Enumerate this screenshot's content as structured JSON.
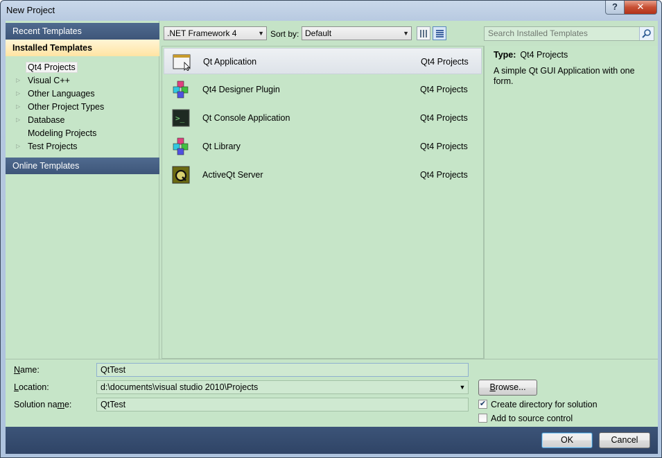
{
  "window": {
    "title": "New Project",
    "help_label": "?",
    "close_label": "✕"
  },
  "left_panel": {
    "recent_label": "Recent Templates",
    "installed_label": "Installed Templates",
    "online_label": "Online Templates",
    "tree": [
      {
        "label": "Qt4 Projects",
        "expandable": false,
        "selected": true
      },
      {
        "label": "Visual C++",
        "expandable": true
      },
      {
        "label": "Other Languages",
        "expandable": true
      },
      {
        "label": "Other Project Types",
        "expandable": true
      },
      {
        "label": "Database",
        "expandable": true
      },
      {
        "label": "Modeling Projects",
        "expandable": false
      },
      {
        "label": "Test Projects",
        "expandable": true
      }
    ]
  },
  "toolbar": {
    "framework": ".NET Framework 4",
    "sort_label": "Sort by:",
    "sort_value": "Default",
    "search_placeholder": "Search Installed Templates"
  },
  "templates": [
    {
      "name": "Qt Application",
      "category": "Qt4 Projects",
      "icon": "window-icon",
      "selected": true
    },
    {
      "name": "Qt4 Designer Plugin",
      "category": "Qt4 Projects",
      "icon": "cubes-icon"
    },
    {
      "name": "Qt Console Application",
      "category": "Qt4 Projects",
      "icon": "console-icon"
    },
    {
      "name": "Qt Library",
      "category": "Qt4 Projects",
      "icon": "cubes-icon"
    },
    {
      "name": "ActiveQt Server",
      "category": "Qt4 Projects",
      "icon": "activeqt-icon"
    }
  ],
  "details": {
    "type_label": "Type:",
    "type_value": "Qt4 Projects",
    "description": "A simple Qt GUI Application with one form."
  },
  "form": {
    "name_label": "Name:",
    "name_value": "QtTest",
    "location_label": "Location:",
    "location_value": "d:\\documents\\visual studio 2010\\Projects",
    "solution_label": "Solution name:",
    "solution_value": "QtTest",
    "browse_label": "Browse...",
    "create_dir_label": "Create directory for solution",
    "create_dir_checked": true,
    "source_control_label": "Add to source control",
    "source_control_checked": false
  },
  "buttons": {
    "ok_label": "OK",
    "cancel_label": "Cancel"
  }
}
